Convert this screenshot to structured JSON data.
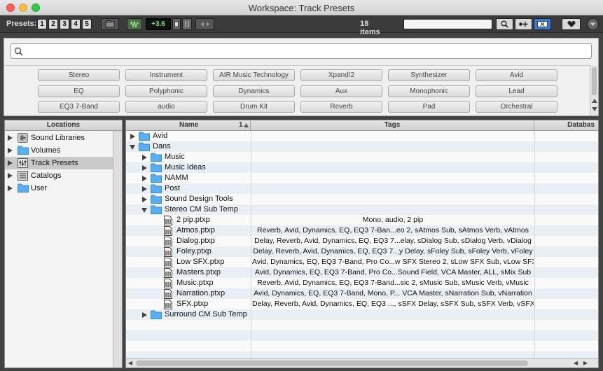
{
  "window": {
    "title": "Workspace: Track Presets"
  },
  "toolbar": {
    "presets_label": "Presets:",
    "preset_buttons": [
      "1",
      "2",
      "3",
      "4",
      "5"
    ],
    "level": "+3.6",
    "items_count": "18 items",
    "search_value": ""
  },
  "tag_area": {
    "search_placeholder": "",
    "tags": [
      [
        "Stereo",
        "Instrument",
        "AIR Music Technology",
        "Xpand!2",
        "Synthesizer",
        "Avid"
      ],
      [
        "EQ",
        "Polyphonic",
        "Dynamics",
        "Aux",
        "Monophonic",
        "Lead"
      ],
      [
        "EQ3 7-Band",
        "audio",
        "Drum Kit",
        "Reverb",
        "Pad",
        "Orchestral"
      ]
    ]
  },
  "locations": {
    "header": "Locations",
    "items": [
      {
        "label": "Sound Libraries",
        "icon": "sound-library-icon"
      },
      {
        "label": "Volumes",
        "icon": "folder-icon"
      },
      {
        "label": "Track Presets",
        "icon": "track-presets-icon",
        "selected": true
      },
      {
        "label": "Catalogs",
        "icon": "catalog-icon"
      },
      {
        "label": "User",
        "icon": "folder-icon"
      }
    ]
  },
  "browser": {
    "columns": {
      "name": "Name",
      "sort_index": "1",
      "tags": "Tags",
      "database": "Databas"
    },
    "rows": [
      {
        "name": "Avid",
        "level": 0,
        "type": "folder",
        "expanded": false,
        "tags": ""
      },
      {
        "name": "Dans",
        "level": 0,
        "type": "folder",
        "expanded": true,
        "tags": ""
      },
      {
        "name": "Music",
        "level": 1,
        "type": "folder",
        "expanded": false,
        "tags": ""
      },
      {
        "name": "Music Ideas",
        "level": 1,
        "type": "folder",
        "expanded": false,
        "tags": ""
      },
      {
        "name": "NAMM",
        "level": 1,
        "type": "folder",
        "expanded": false,
        "tags": ""
      },
      {
        "name": "Post",
        "level": 1,
        "type": "folder",
        "expanded": false,
        "tags": ""
      },
      {
        "name": "Sound Design Tools",
        "level": 1,
        "type": "folder",
        "expanded": false,
        "tags": ""
      },
      {
        "name": "Stereo CM Sub Temp",
        "level": 1,
        "type": "folder",
        "expanded": true,
        "tags": ""
      },
      {
        "name": "2 pip.ptxp",
        "level": 2,
        "type": "file",
        "tags": "Mono, audio, 2 pip"
      },
      {
        "name": "Atmos.ptxp",
        "level": 2,
        "type": "file",
        "tags": "Reverb, Avid, Dynamics, EQ, EQ3 7-Ban...eo 2, sAtmos Sub, sAtmos Verb, vAtmos"
      },
      {
        "name": "Dialog.ptxp",
        "level": 2,
        "type": "file",
        "tags": "Delay, Reverb, Avid, Dynamics, EQ, EQ3 7...elay, sDialog Sub, sDialog Verb, vDialog"
      },
      {
        "name": "Foley.ptxp",
        "level": 2,
        "type": "file",
        "tags": "Delay, Reverb, Avid, Dynamics, EQ, EQ3 7...y Delay, sFoley Sub, sFoley Verb, vFoley"
      },
      {
        "name": "Low SFX.ptxp",
        "level": 2,
        "type": "file",
        "tags": "Avid, Dynamics, EQ, EQ3 7-Band, Pro Co...w SFX Stereo 2, sLow SFX Sub, vLow SFX"
      },
      {
        "name": "Masters.ptxp",
        "level": 2,
        "type": "file",
        "tags": "Avid, Dynamics, EQ, EQ3 7-Band, Pro Co...Sound Field, VCA Master, ALL, sMix Sub"
      },
      {
        "name": "Music.ptxp",
        "level": 2,
        "type": "file",
        "tags": "Reverb, Avid, Dynamics, EQ, EQ3 7-Band...sic 2, sMusic Sub, sMusic Verb, vMusic"
      },
      {
        "name": "Narration.ptxp",
        "level": 2,
        "type": "file",
        "tags": "Avid, Dynamics, EQ, EQ3 7-Band, Mono, P... VCA Master, sNarration Sub, vNarration"
      },
      {
        "name": "SFX.ptxp",
        "level": 2,
        "type": "file",
        "tags": "Delay, Reverb, Avid, Dynamics, EQ, EQ3 ..., sSFX Delay, sSFX Sub, sSFX Verb, vSFX"
      },
      {
        "name": "Surround CM Sub Temp",
        "level": 1,
        "type": "folder",
        "expanded": false,
        "tags": ""
      }
    ]
  }
}
